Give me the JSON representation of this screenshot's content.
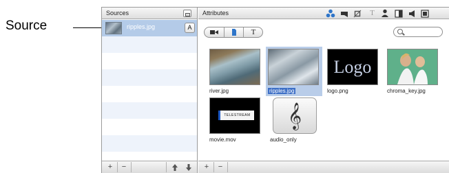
{
  "annotation": {
    "label": "Source"
  },
  "sources_pane": {
    "title": "Sources",
    "header_icon": "panel-toggle-icon",
    "items": [
      {
        "label": "ripples.jpg",
        "thumb_icon": "ripples-thumbnail",
        "attr_button": "A"
      }
    ],
    "bottom": {
      "add": "+",
      "remove": "−",
      "up_icon": "arrow-up-icon",
      "down_icon": "arrow-down-icon"
    }
  },
  "attributes_pane": {
    "title": "Attributes",
    "tool_icons": [
      "sources-icon",
      "movie-icon",
      "crop-icon",
      "text-icon",
      "person-icon",
      "split-icon",
      "audio-icon",
      "settings-icon"
    ],
    "segmented": {
      "video": "■◀",
      "file": "■",
      "text": "T"
    },
    "search": {
      "placeholder": ""
    },
    "bottom": {
      "add": "+",
      "remove": "−"
    }
  },
  "assets": [
    {
      "label": "river.jpg",
      "selected": false
    },
    {
      "label": "ripples.jpg",
      "selected": true
    },
    {
      "label": "logo.png",
      "overlay": "Logo",
      "selected": false
    },
    {
      "label": "chroma_key.jpg",
      "selected": false
    },
    {
      "label": "movie.mov",
      "overlay": "TELESTREAM",
      "selected": false
    },
    {
      "label": "audio_only",
      "overlay": "𝄞",
      "selected": false
    }
  ],
  "colors": {
    "selection": "#b4cbe8",
    "selection_label": "#3d6fc6",
    "stripe": "#eef3fb",
    "accent_blue": "#2e75c9"
  }
}
